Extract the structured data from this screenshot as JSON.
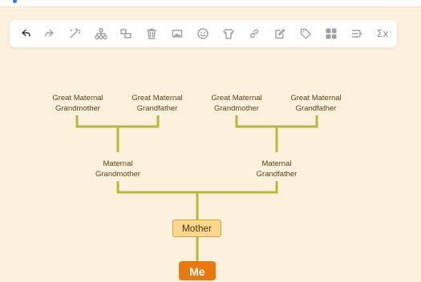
{
  "toolbar": {
    "tools": [
      {
        "name": "undo-icon",
        "icon": "arrow-back"
      },
      {
        "name": "redo-icon",
        "icon": "arrow-forward"
      },
      {
        "name": "format-painter-icon",
        "icon": "magic-wand"
      },
      {
        "name": "structure-icon",
        "icon": "hierarchy"
      },
      {
        "name": "add-topic-icon",
        "icon": "boxes"
      },
      {
        "name": "delete-icon",
        "icon": "trash"
      },
      {
        "name": "image-icon",
        "icon": "picture"
      },
      {
        "name": "emoji-icon",
        "icon": "smiley"
      },
      {
        "name": "style-icon",
        "icon": "t-shirt"
      },
      {
        "name": "link-icon",
        "icon": "chain"
      },
      {
        "name": "note-icon",
        "icon": "pencil-note"
      },
      {
        "name": "tag-icon",
        "icon": "tag"
      },
      {
        "name": "layout-icon",
        "icon": "grid"
      },
      {
        "name": "summary-icon",
        "icon": "summary-bracket"
      },
      {
        "name": "formula-icon",
        "icon": "sigma",
        "glyph": "Σx"
      }
    ]
  },
  "tree": {
    "great_maternal_grandmother_1": [
      "Great Maternal",
      "Grandmother"
    ],
    "great_maternal_grandfather_1": [
      "Great Maternal",
      "Grandfather"
    ],
    "great_maternal_grandmother_2": [
      "Great Maternal",
      "Grandmother"
    ],
    "great_maternal_grandfather_2": [
      "Great Maternal",
      "Grandfather"
    ],
    "maternal_grandmother": [
      "Maternal",
      "Grandmother"
    ],
    "maternal_grandfather": [
      "Maternal",
      "Grandfather"
    ],
    "mother": "Mother",
    "me": "Me"
  },
  "colors": {
    "canvas": "#fdf0dc",
    "connector": "#b5b93c",
    "mother_fill": "#fcd88f",
    "me_fill": "#e8790e"
  }
}
